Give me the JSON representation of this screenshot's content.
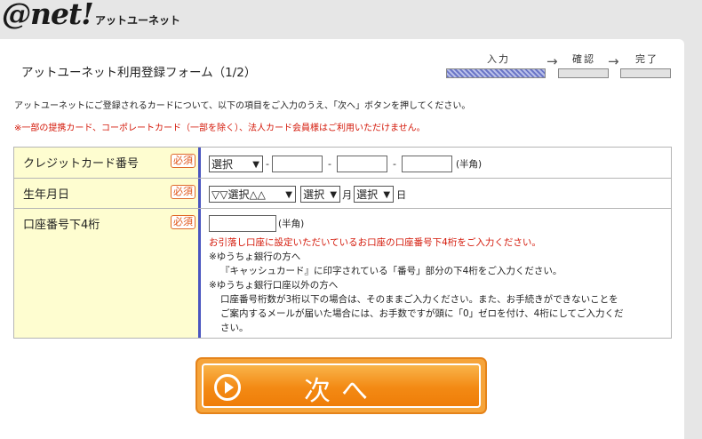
{
  "brand": {
    "logo": "@net!",
    "logo_sub": "アットユーネット"
  },
  "page": {
    "title": "アットユーネット利用登録フォーム（1/2）",
    "intro": "アットユーネットにご登録されるカードについて、以下の項目をご入力のうえ、「次へ」ボタンを押してください。",
    "notice": "※一部の提携カード、コーポレートカード（一部を除く）、法人カード会員様はご利用いただけません。"
  },
  "steps": [
    {
      "label": "入力",
      "active": true
    },
    {
      "label": "確認",
      "active": false
    },
    {
      "label": "完了",
      "active": false
    }
  ],
  "step_arrow": "→",
  "required_badge": "必須",
  "form": {
    "card_number": {
      "label": "クレジットカード番号",
      "brand_select": "選択",
      "separator": "-",
      "unit": "(半角)"
    },
    "birth_date": {
      "label": "生年月日",
      "era_select": "▽▽選択△△",
      "month_select": "選択",
      "month_unit": "月",
      "day_select": "選択",
      "day_unit": "日"
    },
    "account_last4": {
      "label": "口座番号下4桁",
      "unit": "(半角)",
      "note_red": "お引落し口座に設定いただいているお口座の口座番号下4桁をご入力ください。",
      "note_yucho_head": "※ゆうちょ銀行の方へ",
      "note_yucho_body": "『キャッシュカード』に印字されている「番号」部分の下4桁をご入力ください。",
      "note_other_head": "※ゆうちょ銀行口座以外の方へ",
      "note_other_1": "口座番号桁数が3桁以下の場合は、そのままご入力ください。また、お手続きができないことを",
      "note_other_2": "ご案内するメールが届いた場合には、お手数ですが頭に「0」ゼロを付け、4桁にしてご入力くだ",
      "note_other_3": "さい。"
    }
  },
  "next_button": {
    "label": "次へ"
  }
}
